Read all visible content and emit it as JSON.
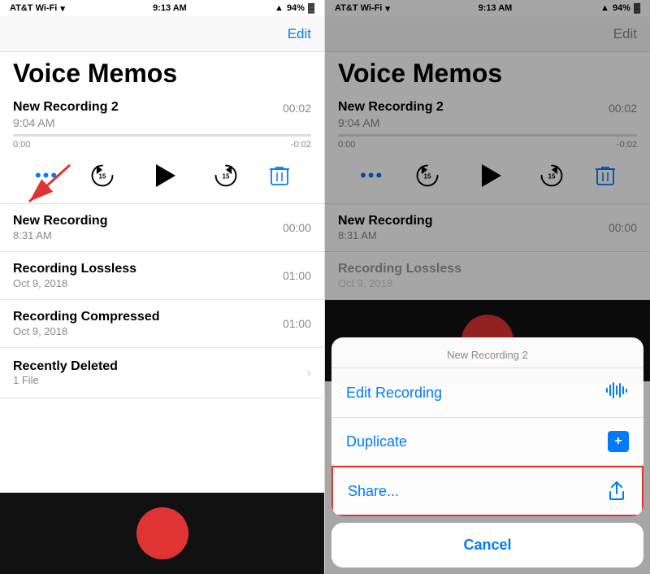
{
  "app": {
    "title": "Voice Memos",
    "status_bar": {
      "carrier": "AT&T Wi-Fi",
      "time": "9:13 AM",
      "battery": "94%"
    }
  },
  "left_panel": {
    "nav": {
      "edit_label": "Edit"
    },
    "recordings": [
      {
        "title": "New Recording 2",
        "subtitle": "9:04 AM",
        "duration": "00:02",
        "expanded": true,
        "progress_start": "0:00",
        "progress_end": "-0:02"
      },
      {
        "title": "New Recording",
        "subtitle": "8:31 AM",
        "duration": "00:00"
      },
      {
        "title": "Recording Lossless",
        "subtitle": "Oct 9, 2018",
        "duration": "01:00"
      },
      {
        "title": "Recording Compressed",
        "subtitle": "Oct 9, 2018",
        "duration": "01:00"
      }
    ],
    "recently_deleted": {
      "title": "Recently Deleted",
      "count": "1 File"
    }
  },
  "right_panel": {
    "nav": {
      "edit_label": "Edit"
    },
    "action_sheet": {
      "recording_name": "New Recording 2",
      "items": [
        {
          "label": "Edit Recording",
          "icon": "waveform"
        },
        {
          "label": "Duplicate",
          "icon": "duplicate"
        },
        {
          "label": "Share...",
          "icon": "share",
          "highlighted": true
        }
      ],
      "cancel_label": "Cancel"
    }
  }
}
